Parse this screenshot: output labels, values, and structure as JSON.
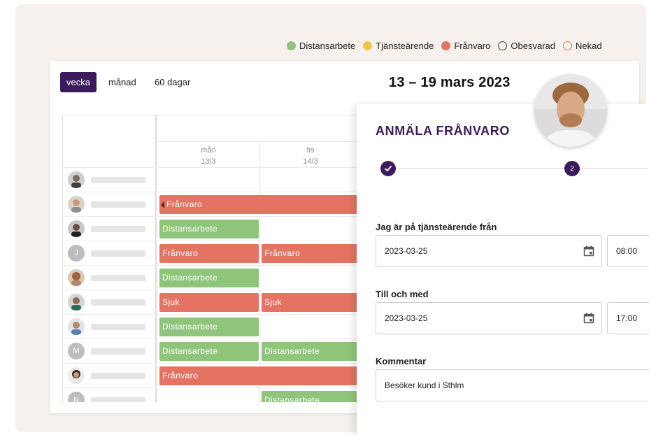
{
  "legend": [
    {
      "label": "Distansarbete",
      "color": "#8fc57a",
      "filled": true
    },
    {
      "label": "Tjänsteärende",
      "color": "#f0c54e",
      "filled": true
    },
    {
      "label": "Frånvaro",
      "color": "#e57363",
      "filled": true
    },
    {
      "label": "Obesvarad",
      "color": "#444444",
      "filled": false
    },
    {
      "label": "Nekad",
      "color": "#e57363",
      "filled": false
    }
  ],
  "calendar": {
    "views": [
      "vecka",
      "månad",
      "60 dagar"
    ],
    "active_view": "vecka",
    "title": "13 – 19 mars 2023",
    "days": [
      {
        "weekday": "mån",
        "date": "13/3"
      },
      {
        "weekday": "tis",
        "date": "14/3"
      }
    ],
    "rows": [
      {
        "avatar": "photo-icon",
        "events": []
      },
      {
        "avatar": "photo-icon",
        "events": [
          {
            "label": "Frånvaro",
            "type": "red",
            "continued": true
          }
        ]
      },
      {
        "avatar": "photo-icon",
        "events": [
          {
            "label": "Distansarbete",
            "type": "green"
          }
        ]
      },
      {
        "avatar": "J",
        "events": [
          {
            "label": "Frånvaro",
            "type": "red"
          },
          {
            "label": "Frånvaro",
            "type": "red"
          }
        ]
      },
      {
        "avatar": "photo-icon",
        "events": [
          {
            "label": "Distansarbete",
            "type": "green"
          }
        ]
      },
      {
        "avatar": "photo-icon",
        "events": [
          {
            "label": "Sjuk",
            "type": "red"
          },
          {
            "label": "Sjuk",
            "type": "red"
          }
        ]
      },
      {
        "avatar": "photo-icon",
        "events": [
          {
            "label": "Distansarbete",
            "type": "green"
          }
        ]
      },
      {
        "avatar": "M",
        "events": [
          {
            "label": "Distansarbete",
            "type": "green"
          },
          {
            "label": "Distansarbete",
            "type": "green"
          }
        ]
      },
      {
        "avatar": "photo-icon",
        "events": [
          {
            "label": "Frånvaro",
            "type": "red"
          }
        ]
      },
      {
        "avatar": "N",
        "events": [
          {
            "label": "Distansarbete",
            "type": "green"
          }
        ]
      }
    ]
  },
  "form": {
    "title": "ANMÄLA FRÅNVARO",
    "steps": [
      "✓",
      "2"
    ],
    "from_label": "Jag är på tjänsteärende från",
    "from_date": "2023-03-25",
    "from_time": "08:00",
    "to_label": "Till och med",
    "to_date": "2023-03-25",
    "to_time": "17:00",
    "comment_label": "Kommentar",
    "comment_value": "Besöker kund i Sthlm"
  }
}
